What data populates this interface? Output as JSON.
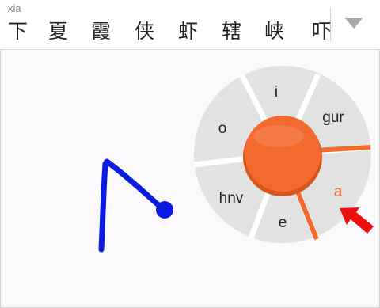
{
  "candidate_bar": {
    "pinyin": "xia",
    "candidates": [
      "下",
      "夏",
      "霞",
      "侠",
      "虾",
      "辖",
      "峡",
      "吓"
    ]
  },
  "icons": {
    "expand": "triangle-down-icon",
    "arrow": "red-arrow-icon"
  },
  "gesture_wheel": {
    "center_color": "#f26a2e",
    "sectors": [
      "i",
      "gur",
      "a",
      "e",
      "hnv",
      "o"
    ],
    "selected": "a"
  },
  "colors": {
    "stroke": "#0b1be0",
    "sector_fill": "#e2e2e2",
    "accent": "#f26a2e",
    "arrow": "#ee0e0e"
  }
}
